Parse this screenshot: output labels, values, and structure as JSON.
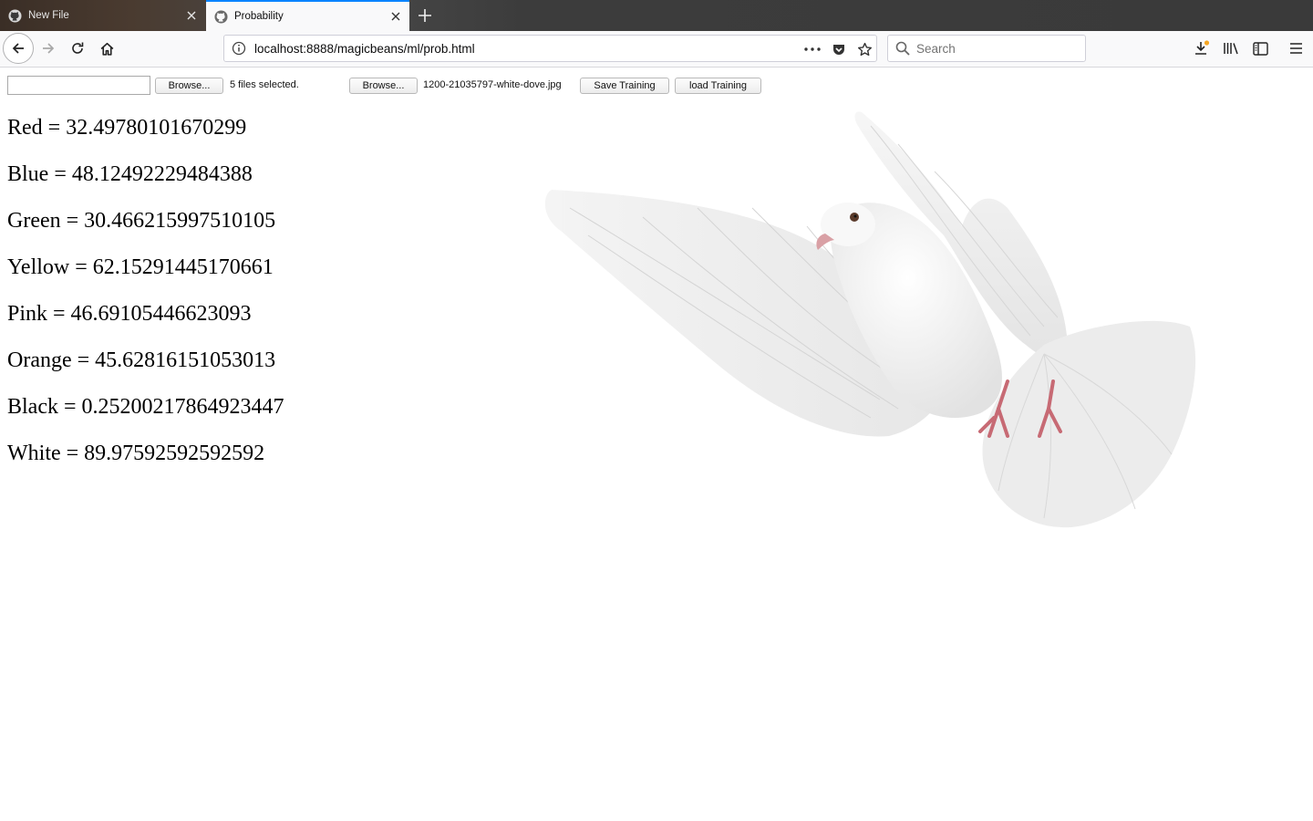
{
  "tabs": [
    {
      "title": "New File",
      "icon": "github-icon",
      "active": false
    },
    {
      "title": "Probability",
      "icon": "github-icon",
      "active": true
    }
  ],
  "navbar": {
    "url": "localhost:8888/magicbeans/ml/prob.html",
    "search_placeholder": "Search"
  },
  "form": {
    "browse1_label": "Browse...",
    "files_selected_text": "5 files selected.",
    "browse2_label": "Browse...",
    "selected_filename": "1200-21035797-white-dove.jpg",
    "save_label": "Save Training",
    "load_label": "load Training"
  },
  "results": [
    {
      "label": "Red = 32.49780101670299"
    },
    {
      "label": "Blue = 48.12492229484388"
    },
    {
      "label": "Green = 30.466215997510105"
    },
    {
      "label": "Yellow = 62.15291445170661"
    },
    {
      "label": "Pink = 46.69105446623093"
    },
    {
      "label": "Orange = 45.62816151053013"
    },
    {
      "label": "Black = 0.25200217864923447"
    },
    {
      "label": "White = 89.97592592592592"
    }
  ],
  "image": {
    "subject": "white dove in flight",
    "icon": "dove-image"
  },
  "colors": {
    "accent": "#0a84ff",
    "tab_strip": "#3a3a3a",
    "toolbar": "#f9f9fa"
  }
}
